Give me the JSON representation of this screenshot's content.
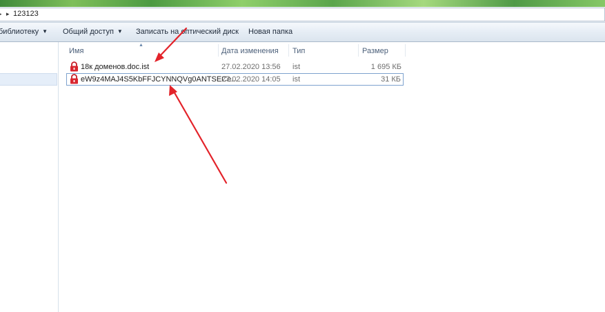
{
  "address_bar": {
    "path": "123123"
  },
  "toolbar": {
    "library_label": "библиотеку",
    "share_label": "Общий доступ",
    "burn_label": "Записать на оптический диск",
    "new_folder_label": "Новая папка"
  },
  "columns": {
    "name": "Имя",
    "date": "Дата изменения",
    "type": "Тип",
    "size": "Размер"
  },
  "files": [
    {
      "icon": "lock-icon",
      "name": "18к доменов.doc.ist",
      "date": "27.02.2020 13:56",
      "type": "ist",
      "size": "1 695 КБ"
    },
    {
      "icon": "lock-icon",
      "name": "eW9z4MAJ4S5KbFFJCYNNQVg0ANTSECe...",
      "date": "27.02.2020 14:05",
      "type": "ist",
      "size": "31 КБ"
    }
  ],
  "colors": {
    "annotation_arrow": "#e3232a",
    "lock_icon": "#d8262f",
    "selection_border": "#7da2ce"
  }
}
